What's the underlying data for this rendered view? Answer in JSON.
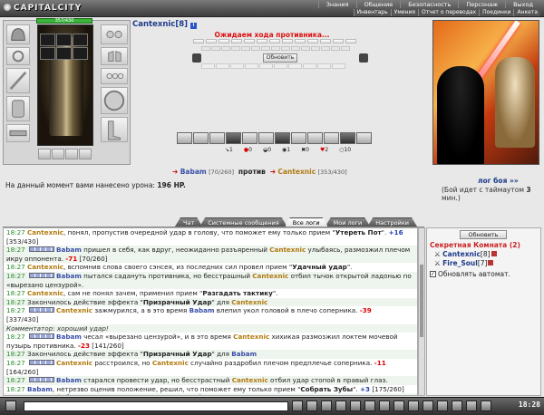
{
  "top": {
    "logo": "CAPITALCITY",
    "hp": "357/430",
    "nav_primary": [
      "Знания",
      "Общение",
      "Безопасность",
      "Персонаж",
      "Выход"
    ],
    "nav_secondary": [
      "Инвентарь",
      "Умения",
      "Отчет о переводах",
      "Поединки",
      "Анкета"
    ]
  },
  "arena": {
    "opponent": "Cantexnic",
    "opponent_level": "[8]",
    "waiting": "Ожидаем хода противника...",
    "refresh": "Обновить",
    "counters": [
      {
        "icon": "sword",
        "value": "1"
      },
      {
        "icon": "drop",
        "value": "0"
      },
      {
        "icon": "shield",
        "value": "0"
      },
      {
        "icon": "eye",
        "value": "1"
      },
      {
        "icon": "cross",
        "value": "0"
      },
      {
        "icon": "heart",
        "value": "2"
      },
      {
        "icon": "circle",
        "value": "10"
      }
    ]
  },
  "vs": {
    "left_name": "Babam",
    "left_hp": "[70/260]",
    "word": "против",
    "right_name": "Cantexnic",
    "right_hp": "[353/430]"
  },
  "battle": {
    "log_link": "лог боя »»",
    "timeout_prefix": "(Бой идет с таймаутом ",
    "timeout_value": "3",
    "timeout_suffix": " мин.)",
    "damage_prefix": "На данный момент вами нанесено урона: ",
    "damage_value": "196 HP."
  },
  "tabs": [
    "Чат",
    "Системные сообщения",
    "Все логи",
    "Мои логи",
    "Настройки"
  ],
  "room": {
    "refresh": "Обновить",
    "title": "Секретная Комната (2)",
    "users": [
      {
        "name": "Cantexnic",
        "level": "[8]"
      },
      {
        "name": "Fire_Soul",
        "level": "[7]"
      }
    ],
    "auto_update": "Обновлять автомат."
  },
  "clock": "18:28"
}
